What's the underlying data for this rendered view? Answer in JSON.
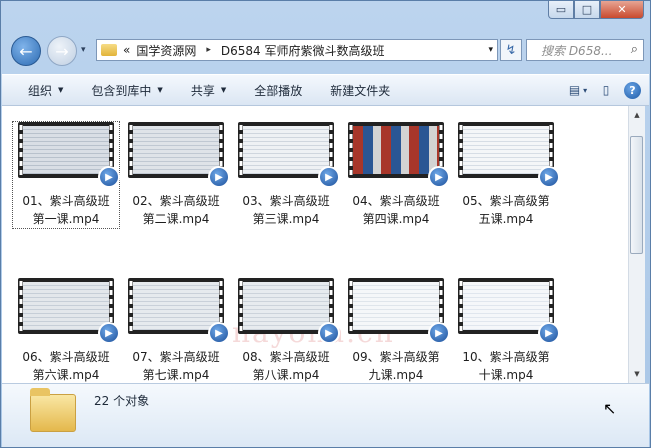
{
  "window": {
    "caption_min": "▭",
    "caption_max": "□",
    "caption_close": "✕"
  },
  "address": {
    "prefix": "«",
    "segments": [
      "国学资源网",
      "D6584 军师府紫微斗数高级班"
    ],
    "separator": "▸",
    "dropdown": "▾"
  },
  "nav": {
    "back": "←",
    "forward": "→",
    "history": "▾",
    "refresh": "↯"
  },
  "search": {
    "placeholder": "搜索 D658...",
    "icon": "⌕"
  },
  "toolbar": {
    "items": [
      {
        "label": "组织",
        "has_menu": true
      },
      {
        "label": "包含到库中",
        "has_menu": true
      },
      {
        "label": "共享",
        "has_menu": true
      },
      {
        "label": "全部播放",
        "has_menu": false
      },
      {
        "label": "新建文件夹",
        "has_menu": false
      }
    ],
    "menu_arrow": "▼",
    "view_icon": "▤",
    "view_arrow": "▾",
    "pane_icon": "▯",
    "help": "?"
  },
  "files": [
    {
      "line1": "01、紫斗高级班",
      "line2": "第一课.mp4",
      "selected": true
    },
    {
      "line1": "02、紫斗高级班",
      "line2": "第二课.mp4"
    },
    {
      "line1": "03、紫斗高级班",
      "line2": "第三课.mp4"
    },
    {
      "line1": "04、紫斗高级班",
      "line2": "第四课.mp4"
    },
    {
      "line1": "05、紫斗高级第",
      "line2": "五课.mp4"
    },
    {
      "line1": "06、紫斗高级班",
      "line2": "第六课.mp4"
    },
    {
      "line1": "07、紫斗高级班",
      "line2": "第七课.mp4"
    },
    {
      "line1": "08、紫斗高级班",
      "line2": "第八课.mp4"
    },
    {
      "line1": "09、紫斗高级第",
      "line2": "九课.mp4"
    },
    {
      "line1": "10、紫斗高级第",
      "line2": "十课.mp4"
    }
  ],
  "play_glyph": "▶",
  "watermark": "nayona.cn",
  "scroll": {
    "up": "▲",
    "down": "▼"
  },
  "details": {
    "count": "22 个对象"
  },
  "cursor": "↖"
}
